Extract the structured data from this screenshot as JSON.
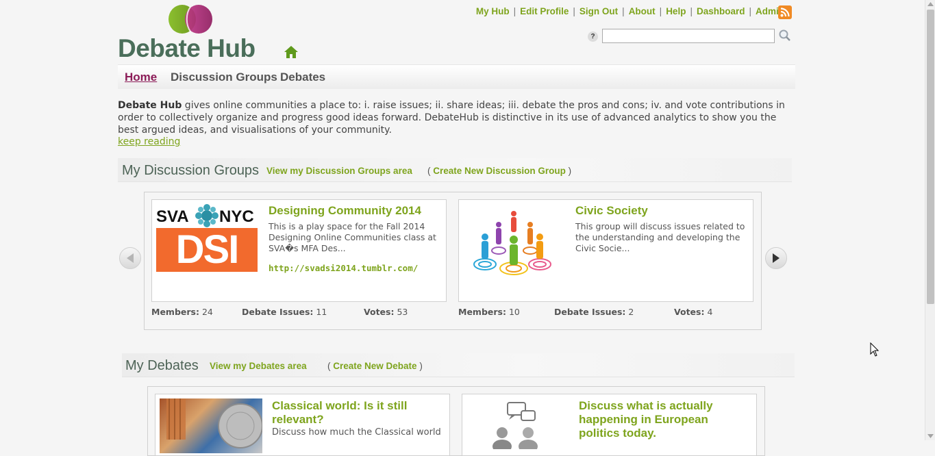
{
  "header": {
    "logo_text": "Debate Hub",
    "top_links": [
      "My Hub",
      "Edit Profile",
      "Sign Out",
      "About",
      "Help",
      "Dashboard",
      "Admin"
    ],
    "search_placeholder": "",
    "help_icon": "?"
  },
  "nav": {
    "items": [
      "Home",
      "Discussion Groups",
      "Debates"
    ],
    "active": "Home"
  },
  "intro": {
    "bold": "Debate Hub",
    "text": " gives online communities a place to: i. raise issues; ii. share ideas; iii. debate the pros and cons; iv. and vote contributions in order to collectively organize and progress good ideas forward. DebateHub is distinctive in its use of advanced analytics to show you the best argued ideas, and visualisations of your community.",
    "keep_reading": "keep reading"
  },
  "groups_section": {
    "title": "My Discussion Groups",
    "view_link": "View my Discussion Groups area",
    "paren_open": "(",
    "create_link": "Create New Discussion Group",
    "paren_close": ")",
    "cards": [
      {
        "title": "Designing Community 2014",
        "desc": "This is a play space for the Fall 2014 Designing Online Communities class at SVA�s MFA Des...",
        "link": "http://svadsi2014.tumblr.com/",
        "members_label": "Members:",
        "members": "24",
        "issues_label": "Debate Issues:",
        "issues": "11",
        "votes_label": "Votes:",
        "votes": "53",
        "logo_top": "SVA",
        "logo_top2": "NYC",
        "logo_bottom": "DSI"
      },
      {
        "title": "Civic Society",
        "desc": "This group will discuss issues related to the understanding and developing the Civic Socie...",
        "link": "",
        "members_label": "Members:",
        "members": "10",
        "issues_label": "Debate Issues:",
        "issues": "2",
        "votes_label": "Votes:",
        "votes": "4"
      }
    ]
  },
  "debates_section": {
    "title": "My Debates",
    "view_link": "View my Debates area",
    "paren_open": "(",
    "create_link": "Create New Debate",
    "paren_close": ")",
    "cards": [
      {
        "title": "Classical world: Is it still relevant?",
        "desc": "Discuss how much the Classical world"
      },
      {
        "title": "Discuss what is actually happening in European politics today."
      }
    ]
  },
  "colors": {
    "accent_green": "#7ea41d",
    "active_purple": "#8b1b57",
    "logo_green": "#4a6e5a",
    "rss_orange": "#f08a24"
  },
  "icons": [
    "home-icon",
    "rss-icon",
    "help-icon",
    "search-icon",
    "arrow-left-icon",
    "arrow-right-icon",
    "mouse-cursor-icon"
  ]
}
